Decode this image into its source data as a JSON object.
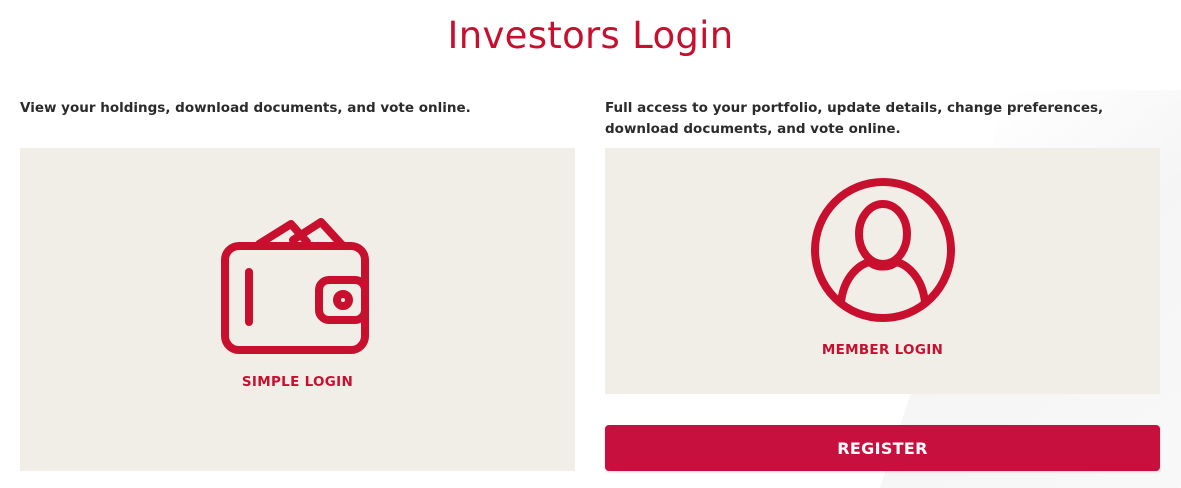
{
  "page": {
    "title": "Investors Login"
  },
  "simple": {
    "description": "View your holdings, download documents, and vote online.",
    "label": "SIMPLE LOGIN",
    "icon": "wallet-icon"
  },
  "member": {
    "description": "Full access to your portfolio, update details, change preferences, download documents, and vote online.",
    "label": "MEMBER LOGIN",
    "icon": "user-avatar-icon"
  },
  "register": {
    "label": "REGISTER"
  },
  "colors": {
    "accent": "#c8102e",
    "button": "#c8103f",
    "card_bg": "#f1eee8",
    "text": "#2b2b2b"
  }
}
